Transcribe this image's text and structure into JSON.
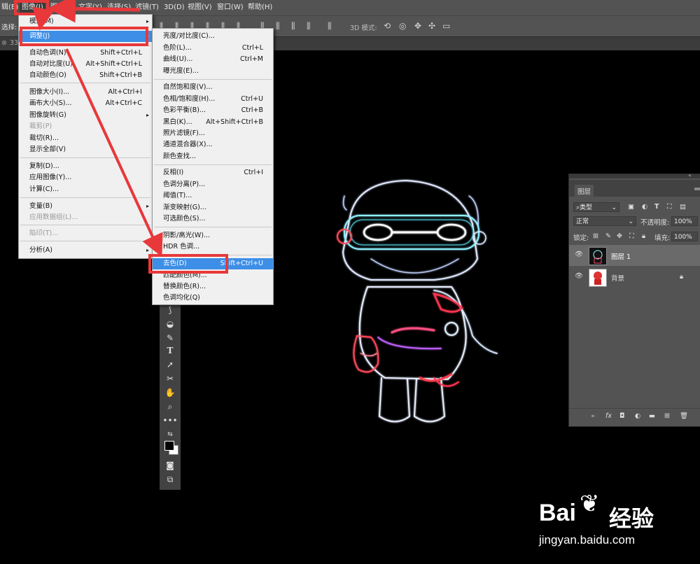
{
  "menubar": {
    "items": [
      "辑(E)",
      "图像(I)",
      "图层(L)",
      "文字(Y)",
      "选择(S)",
      "滤镜(T)",
      "3D(D)",
      "视图(V)",
      "窗口(W)",
      "帮助(H)"
    ]
  },
  "optbar": {
    "select_label": "选择:",
    "mode_3d_label": "3D 模式:"
  },
  "tab": {
    "zoom": "33.3"
  },
  "image_menu": {
    "items": [
      {
        "label": "模式(M)",
        "shortcut": "",
        "arrow": "▸"
      },
      {
        "label": "调整(J)",
        "shortcut": "",
        "arrow": "▸"
      },
      {
        "label": "自动色调(N)",
        "shortcut": "Shift+Ctrl+L"
      },
      {
        "label": "自动对比度(U)",
        "shortcut": "Alt+Shift+Ctrl+L"
      },
      {
        "label": "自动颜色(O)",
        "shortcut": "Shift+Ctrl+B"
      },
      {
        "label": "图像大小(I)...",
        "shortcut": "Alt+Ctrl+I"
      },
      {
        "label": "画布大小(S)...",
        "shortcut": "Alt+Ctrl+C"
      },
      {
        "label": "图像旋转(G)",
        "shortcut": "",
        "arrow": "▸"
      },
      {
        "label": "裁剪(P)",
        "shortcut": ""
      },
      {
        "label": "裁切(R)...",
        "shortcut": ""
      },
      {
        "label": "显示全部(V)",
        "shortcut": ""
      },
      {
        "label": "复制(D)...",
        "shortcut": ""
      },
      {
        "label": "应用图像(Y)...",
        "shortcut": ""
      },
      {
        "label": "计算(C)...",
        "shortcut": ""
      },
      {
        "label": "变量(B)",
        "shortcut": "",
        "arrow": "▸"
      },
      {
        "label": "应用数据组(L)...",
        "shortcut": ""
      },
      {
        "label": "陷印(T)...",
        "shortcut": ""
      },
      {
        "label": "分析(A)",
        "shortcut": "",
        "arrow": "▸"
      }
    ]
  },
  "adjust_menu": {
    "items": [
      {
        "label": "亮度/对比度(C)...",
        "shortcut": ""
      },
      {
        "label": "色阶(L)...",
        "shortcut": "Ctrl+L"
      },
      {
        "label": "曲线(U)...",
        "shortcut": "Ctrl+M"
      },
      {
        "label": "曝光度(E)...",
        "shortcut": ""
      },
      {
        "label": "自然饱和度(V)...",
        "shortcut": ""
      },
      {
        "label": "色相/饱和度(H)...",
        "shortcut": "Ctrl+U"
      },
      {
        "label": "色彩平衡(B)...",
        "shortcut": "Ctrl+B"
      },
      {
        "label": "黑白(K)...",
        "shortcut": "Alt+Shift+Ctrl+B"
      },
      {
        "label": "照片滤镜(F)...",
        "shortcut": ""
      },
      {
        "label": "通道混合器(X)...",
        "shortcut": ""
      },
      {
        "label": "颜色查找...",
        "shortcut": ""
      },
      {
        "label": "反相(I)",
        "shortcut": "Ctrl+I"
      },
      {
        "label": "色调分离(P)...",
        "shortcut": ""
      },
      {
        "label": "阈值(T)...",
        "shortcut": ""
      },
      {
        "label": "渐变映射(G)...",
        "shortcut": ""
      },
      {
        "label": "可选颜色(S)...",
        "shortcut": ""
      },
      {
        "label": "阴影/高光(W)...",
        "shortcut": ""
      },
      {
        "label": "HDR 色调...",
        "shortcut": ""
      },
      {
        "label": "去色(D)",
        "shortcut": "Shift+Ctrl+U"
      },
      {
        "label": "匹配颜色(M)...",
        "shortcut": ""
      },
      {
        "label": "替换颜色(R)...",
        "shortcut": ""
      },
      {
        "label": "色调均化(Q)",
        "shortcut": ""
      }
    ]
  },
  "layers_panel": {
    "title": "图层",
    "filter": "类型",
    "blend_mode": "正常",
    "opacity_label": "不透明度:",
    "opacity": "100%",
    "lock_label": "锁定:",
    "fill_label": "填充:",
    "fill": "100%",
    "layers": [
      {
        "name": "图层 1"
      },
      {
        "name": "背景"
      }
    ]
  },
  "watermark": {
    "brand_a": "Bai",
    "brand_b": "经验",
    "url": "jingyan.baidu.com"
  },
  "colors": {
    "accent": "#3d8ee6",
    "annotation": "#e8383a",
    "panel": "#535353"
  }
}
